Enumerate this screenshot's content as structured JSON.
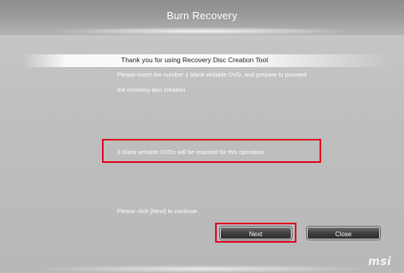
{
  "window": {
    "title": "Burn Recovery"
  },
  "content": {
    "heading": "Thank you for using Recovery Disc Creation Tool",
    "instruction_line1": "Please insert the  number 1  blank writable DVD, and prepare to proceed",
    "instruction_line2": "the recovery disc creation",
    "requirement": "3 blank writable DVDs will be required for this operation",
    "continue_prompt": "Please click [Next] to continue"
  },
  "buttons": {
    "next_label": "Next",
    "close_label": "Close"
  },
  "branding": {
    "logo_text": "msi"
  },
  "colors": {
    "highlight_border": "#e0001a",
    "background": "#c2c2c2",
    "button_fill": "#3f3f3f"
  }
}
